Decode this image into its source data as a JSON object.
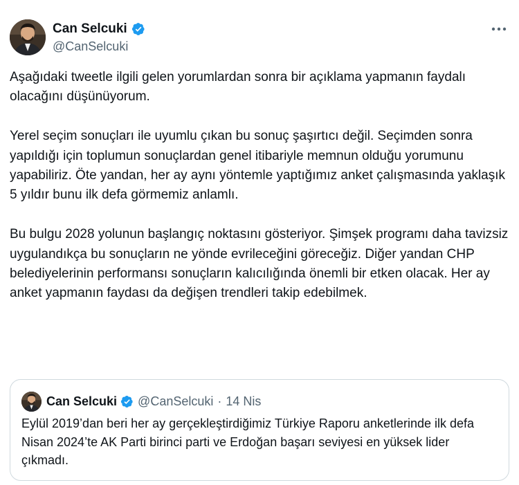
{
  "author": {
    "name": "Can Selcuki",
    "handle": "@CanSelcuki"
  },
  "tweet": {
    "paragraphs": [
      "Aşağıdaki tweetle ilgili gelen yorumlardan sonra bir açıklama yapmanın faydalı olacağını düşünüyorum.",
      "Yerel seçim sonuçları ile uyumlu çıkan bu sonuç şaşırtıcı değil. Seçimden sonra yapıldığı için toplumun sonuçlardan genel itibariyle memnun olduğu yorumunu yapabiliriz. Öte yandan, her ay aynı yöntemle yaptığımız anket çalışmasında yaklaşık 5 yıldır bunu ilk defa görmemiz anlamlı.",
      "Bu bulgu 2028 yolunun başlangıç noktasını gösteriyor. Şimşek programı daha tavizsiz uygulandıkça bu sonuçların ne yönde evrileceğini göreceğiz. Diğer yandan CHP belediyelerinin performansı sonuçların kalıcılığında önemli bir etken olacak. Her ay anket yapmanın faydası da değişen trendleri takip edebilmek."
    ]
  },
  "quoted": {
    "name": "Can Selcuki",
    "handle": "@CanSelcuki",
    "separator": "·",
    "date": "14 Nis",
    "text": "Eylül 2019’dan beri her ay gerçekleştirdiğimiz Türkiye Raporu anketlerinde ilk defa Nisan 2024’te AK Parti birinci parti ve Erdoğan başarı seviyesi en yüksek lider çıkmadı."
  },
  "icons": {
    "verified": "verified-badge-icon",
    "more": "more-options-icon"
  },
  "colors": {
    "verified": "#1d9bf0",
    "text": "#0f1419",
    "secondary": "#536471",
    "border": "#cfd9de"
  }
}
